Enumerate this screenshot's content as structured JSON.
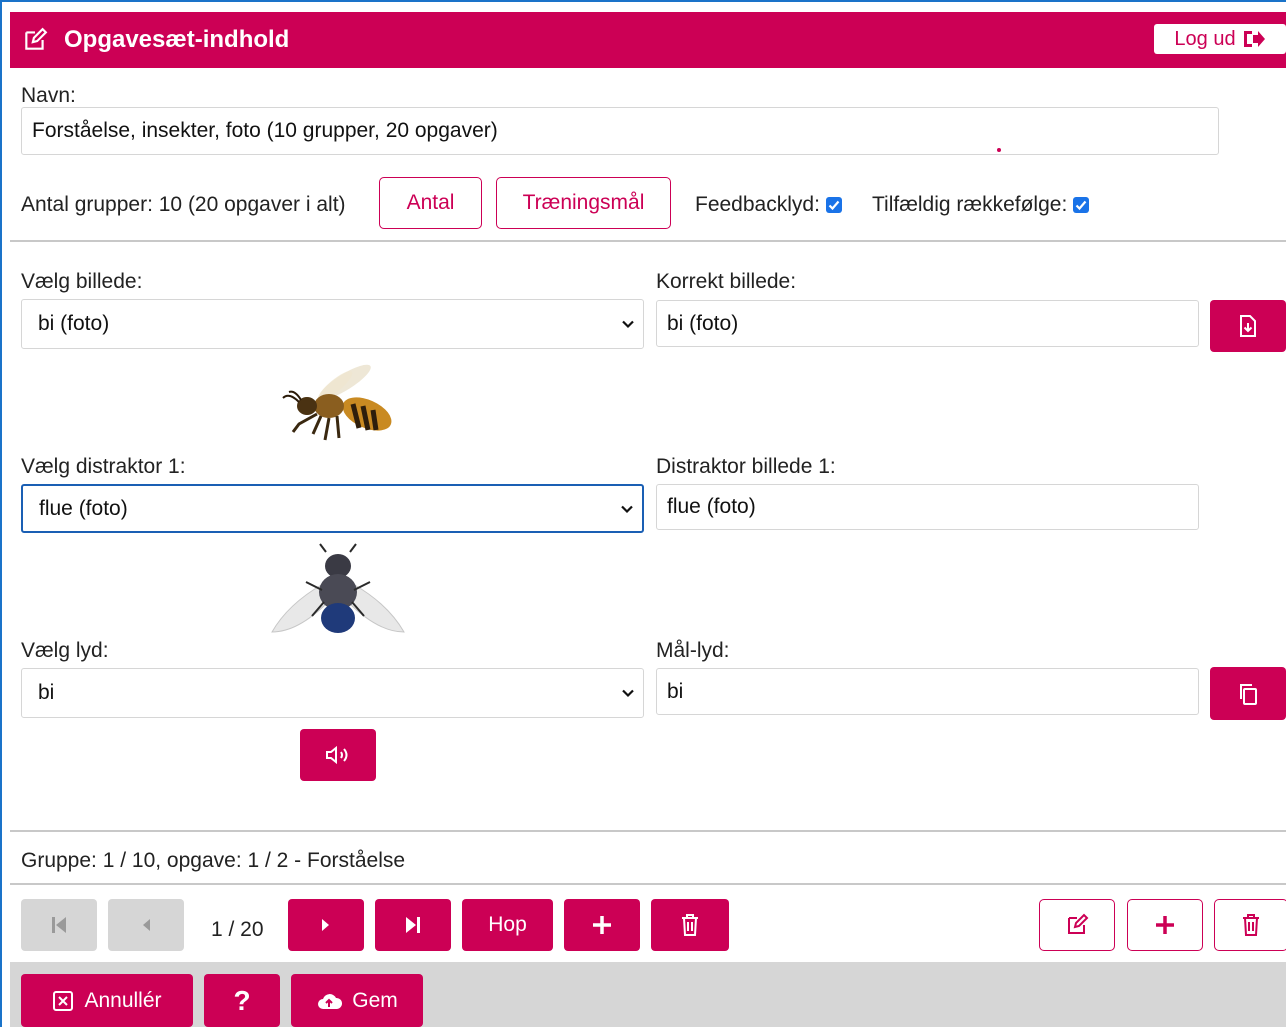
{
  "header": {
    "title": "Opgavesæt-indhold",
    "logout_label": "Log ud"
  },
  "name": {
    "label": "Navn:",
    "value": "Forståelse, insekter, foto (10 grupper, 20 opgaver)"
  },
  "settings": {
    "group_count_text": "Antal grupper: 10 (20 opgaver i alt)",
    "antal_button": "Antal",
    "training_button": "Træningsmål",
    "feedback_label": "Feedbacklyd:",
    "feedback_checked": true,
    "random_label": "Tilfældig rækkefølge:",
    "random_checked": true
  },
  "image_select": {
    "label": "Vælg billede:",
    "value": "bi (foto)"
  },
  "correct_image": {
    "label": "Korrekt billede:",
    "value": "bi (foto)"
  },
  "distractor_select": {
    "label": "Vælg distraktor 1:",
    "value": "flue (foto)"
  },
  "distractor_image": {
    "label": "Distraktor billede 1:",
    "value": "flue (foto)"
  },
  "sound_select": {
    "label": "Vælg lyd:",
    "value": "bi"
  },
  "target_sound": {
    "label": "Mål-lyd:",
    "value": "bi"
  },
  "status": {
    "text": "Gruppe: 1 / 10, opgave: 1 / 2 - Forståelse"
  },
  "nav": {
    "page_indicator": "1 / 20",
    "jump_label": "Hop"
  },
  "footer": {
    "cancel_label": "Annullér",
    "help_label": "?",
    "save_label": "Gem"
  },
  "colors": {
    "accent": "#cc0055",
    "footer_bg": "#d6d6d6",
    "checkbox": "#1a73e8"
  },
  "icons": [
    "edit-icon",
    "logout-icon",
    "file-download-icon",
    "copy-icon",
    "speaker-icon",
    "first-icon",
    "prev-icon",
    "next-icon",
    "last-icon",
    "plus-icon",
    "trash-icon",
    "close-box-icon",
    "cloud-upload-icon"
  ]
}
